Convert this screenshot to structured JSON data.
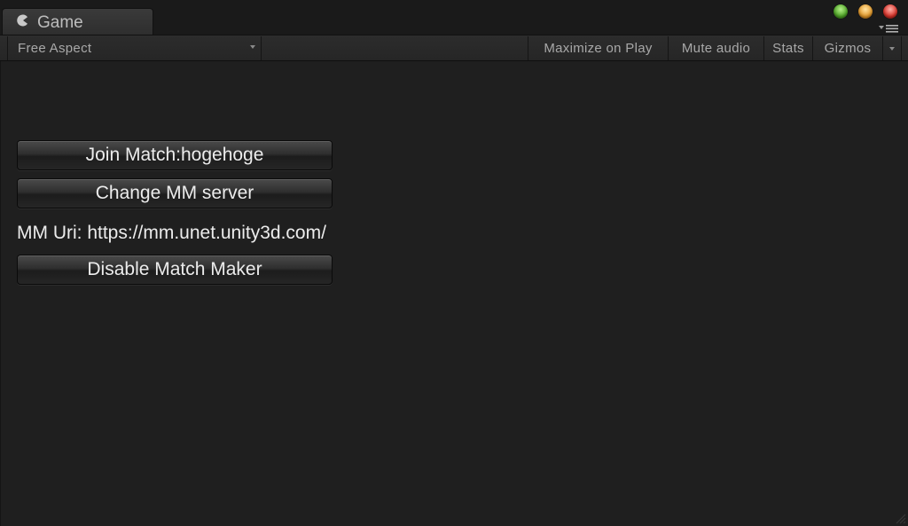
{
  "window": {
    "tab_title": "Game",
    "tab_icon": "pacman-icon"
  },
  "toolbar": {
    "aspect_value": "Free Aspect",
    "maximize_on_play": "Maximize on Play",
    "mute_audio": "Mute audio",
    "stats": "Stats",
    "gizmos": "Gizmos"
  },
  "game": {
    "join_match_button": "Join Match:hogehoge",
    "change_mm_server_button": "Change MM server",
    "mm_uri_text": "MM Uri: https://mm.unet.unity3d.com/",
    "disable_match_maker_button": "Disable Match Maker"
  },
  "colors": {
    "background": "#1f1f1f",
    "toolbar": "#282828",
    "text": "#ececec",
    "toolbar_text": "#a8a8a8",
    "traffic_green": "#4fa427",
    "traffic_yellow": "#e39a2c",
    "traffic_red": "#d8342b"
  }
}
